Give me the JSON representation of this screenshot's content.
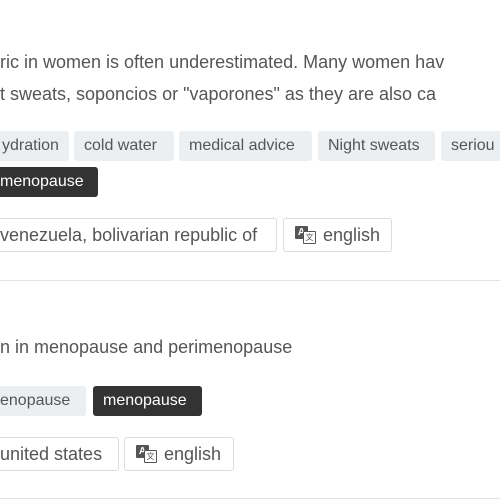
{
  "item1": {
    "description_line1": "ric in women is often underestimated. Many women hav",
    "description_line2": "t sweats, soponcios or \"vaporones\" as they are also ca",
    "tags": [
      "ydration",
      "cold water",
      "medical advice",
      "Night sweats",
      "seriou"
    ],
    "active_tag": "menopause",
    "country": "venezuela, bolivarian republic of",
    "language": "english"
  },
  "item2": {
    "title": "n in menopause and perimenopause",
    "tags": [
      "enopause"
    ],
    "active_tag": "menopause",
    "country": "united states",
    "language": "english"
  },
  "icons": {
    "language": "translate-icon"
  }
}
